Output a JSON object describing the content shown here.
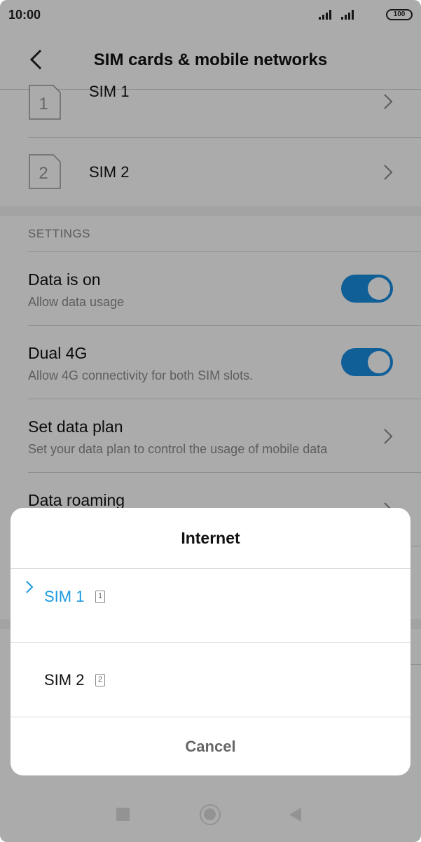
{
  "status_bar": {
    "time": "10:00",
    "battery": "100"
  },
  "header": {
    "title": "SIM cards & mobile networks"
  },
  "sim_list": [
    {
      "label": "SIM 1",
      "slot_number": "1"
    },
    {
      "label": "SIM 2",
      "slot_number": "2"
    }
  ],
  "settings": {
    "section_label": "SETTINGS",
    "items": [
      {
        "title": "Data is on",
        "subtitle": "Allow data usage",
        "toggle_on": true
      },
      {
        "title": "Dual 4G",
        "subtitle": "Allow 4G connectivity for both SIM slots.",
        "toggle_on": true
      },
      {
        "title": "Set data plan",
        "subtitle": "Set your data plan to control the usage of mobile data"
      },
      {
        "title": "Data roaming"
      }
    ]
  },
  "dialog": {
    "title": "Internet",
    "options": [
      {
        "label": "SIM 1",
        "badge": "1",
        "selected": true
      },
      {
        "label": "SIM 2",
        "badge": "2",
        "selected": false
      }
    ],
    "cancel_label": "Cancel"
  },
  "colors": {
    "accent": "#1a8ee2",
    "selected_text": "#1a9ae0",
    "overlay": "#000000"
  }
}
